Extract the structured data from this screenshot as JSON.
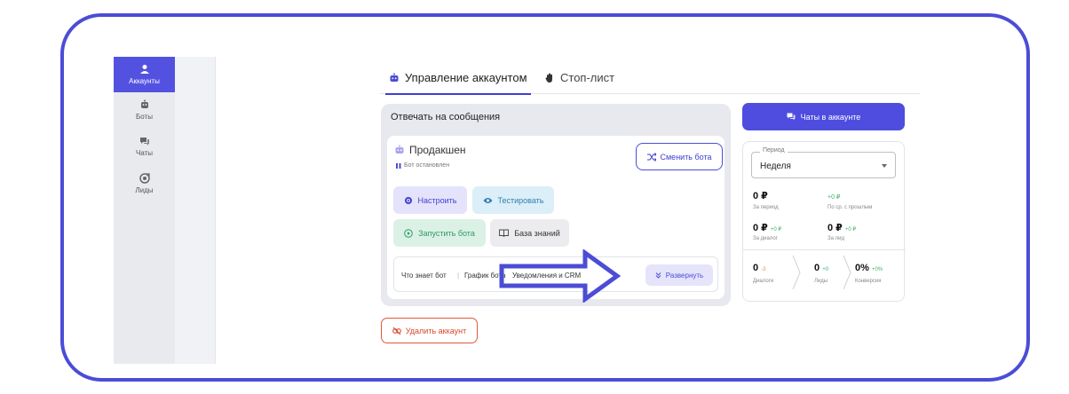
{
  "sidebar": {
    "items": [
      {
        "label": "Аккаунты",
        "icon": "user-icon",
        "active": true
      },
      {
        "label": "Боты",
        "icon": "bot-icon"
      },
      {
        "label": "Чаты",
        "icon": "chat-icon"
      },
      {
        "label": "Лиды",
        "icon": "target-icon"
      }
    ]
  },
  "tabs": [
    {
      "label": "Управление аккаунтом",
      "icon": "bot-icon",
      "active": true
    },
    {
      "label": "Стоп-лист",
      "icon": "hand-icon"
    }
  ],
  "card": {
    "title": "Отвечать на сообщения",
    "bot_name": "Продакшен",
    "bot_status": "Бот остановлен",
    "switch_label": "Сменить бота",
    "actions": {
      "configure": "Настроить",
      "test": "Тестировать",
      "start": "Запустить бота",
      "knowledge": "База знаний"
    },
    "links": [
      "Что знает бот",
      "График бота",
      "Уведомления и CRM"
    ],
    "link_separator": "|",
    "expand_label": "Развернуть"
  },
  "delete_label": "Удалить аккаунт",
  "chats_label": "Чаты в аккаунте",
  "stats": {
    "period_legend": "Период",
    "period_value": "Неделя",
    "total": {
      "value": "0 ₽",
      "caption": "За период"
    },
    "diff": {
      "value": "+0 ₽",
      "caption": "По ср. с прошлым"
    },
    "per_dialog": {
      "value": "0 ₽",
      "delta": "+0 ₽",
      "caption": "За диалог"
    },
    "per_lead": {
      "value": "0 ₽",
      "delta": "+0 ₽",
      "caption": "За лид"
    },
    "dialogs": {
      "value": "0",
      "delta": "-3",
      "caption": "Диалоги"
    },
    "leads": {
      "value": "0",
      "delta": "+0",
      "caption": "Лиды"
    },
    "conversion": {
      "value": "0%",
      "delta": "+0%",
      "caption": "Конверсия"
    }
  },
  "colors": {
    "accent": "#4b4dd6",
    "danger": "#e2573a",
    "positive": "#3bb26a"
  }
}
